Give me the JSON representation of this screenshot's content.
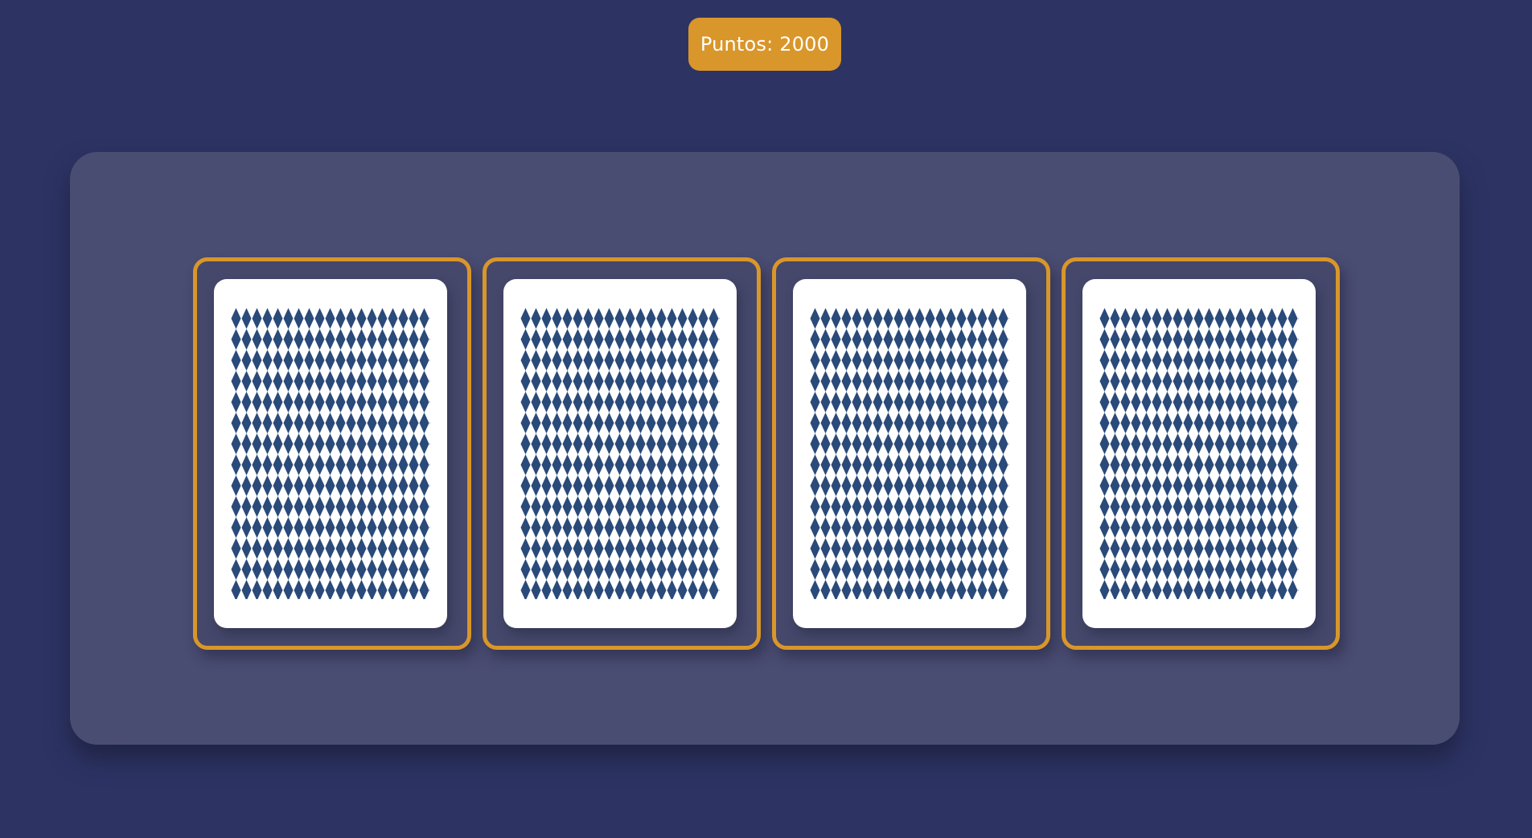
{
  "header": {
    "score_label": "Puntos: 2000"
  },
  "table": {
    "cards": [
      {
        "state": "face-down"
      },
      {
        "state": "face-down"
      },
      {
        "state": "face-down"
      },
      {
        "state": "face-down"
      }
    ]
  },
  "colors": {
    "background": "#2d3464",
    "panel": "#4a4d72",
    "accent": "#d9962a",
    "card_face": "#ffffff",
    "card_pattern": "#2a4a7a"
  }
}
